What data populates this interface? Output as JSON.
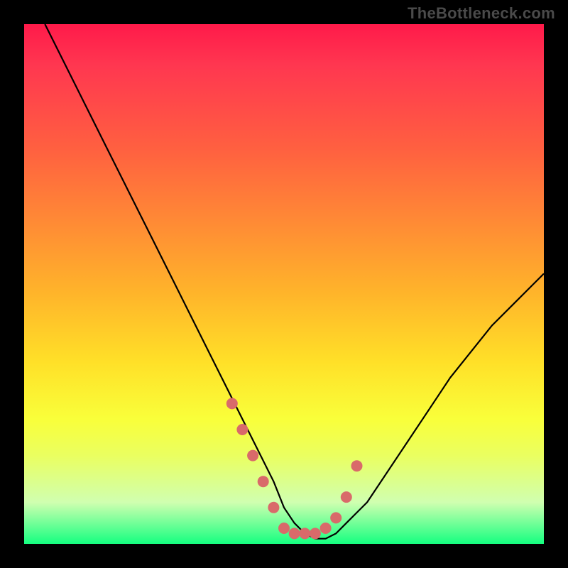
{
  "attribution": "TheBottleneck.com",
  "chart_data": {
    "type": "line",
    "title": "",
    "xlabel": "",
    "ylabel": "",
    "xlim": [
      0,
      100
    ],
    "ylim": [
      0,
      100
    ],
    "series": [
      {
        "name": "bottleneck-curve",
        "x": [
          4,
          8,
          12,
          16,
          20,
          24,
          28,
          32,
          36,
          40,
          44,
          48,
          50,
          52,
          54,
          56,
          58,
          60,
          62,
          66,
          70,
          74,
          78,
          82,
          86,
          90,
          94,
          98,
          100
        ],
        "y": [
          100,
          92,
          84,
          76,
          68,
          60,
          52,
          44,
          36,
          28,
          20,
          12,
          7,
          4,
          2,
          1,
          1,
          2,
          4,
          8,
          14,
          20,
          26,
          32,
          37,
          42,
          46,
          50,
          52
        ]
      }
    ],
    "markers": {
      "name": "highlight-points",
      "x": [
        40,
        42,
        44,
        46,
        48,
        50,
        52,
        54,
        56,
        58,
        60,
        62,
        64
      ],
      "y": [
        27,
        22,
        17,
        12,
        7,
        3,
        2,
        2,
        2,
        3,
        5,
        9,
        15
      ]
    }
  },
  "colors": {
    "curve": "#000000",
    "marker": "#d96a6a",
    "background_frame": "#000000"
  }
}
